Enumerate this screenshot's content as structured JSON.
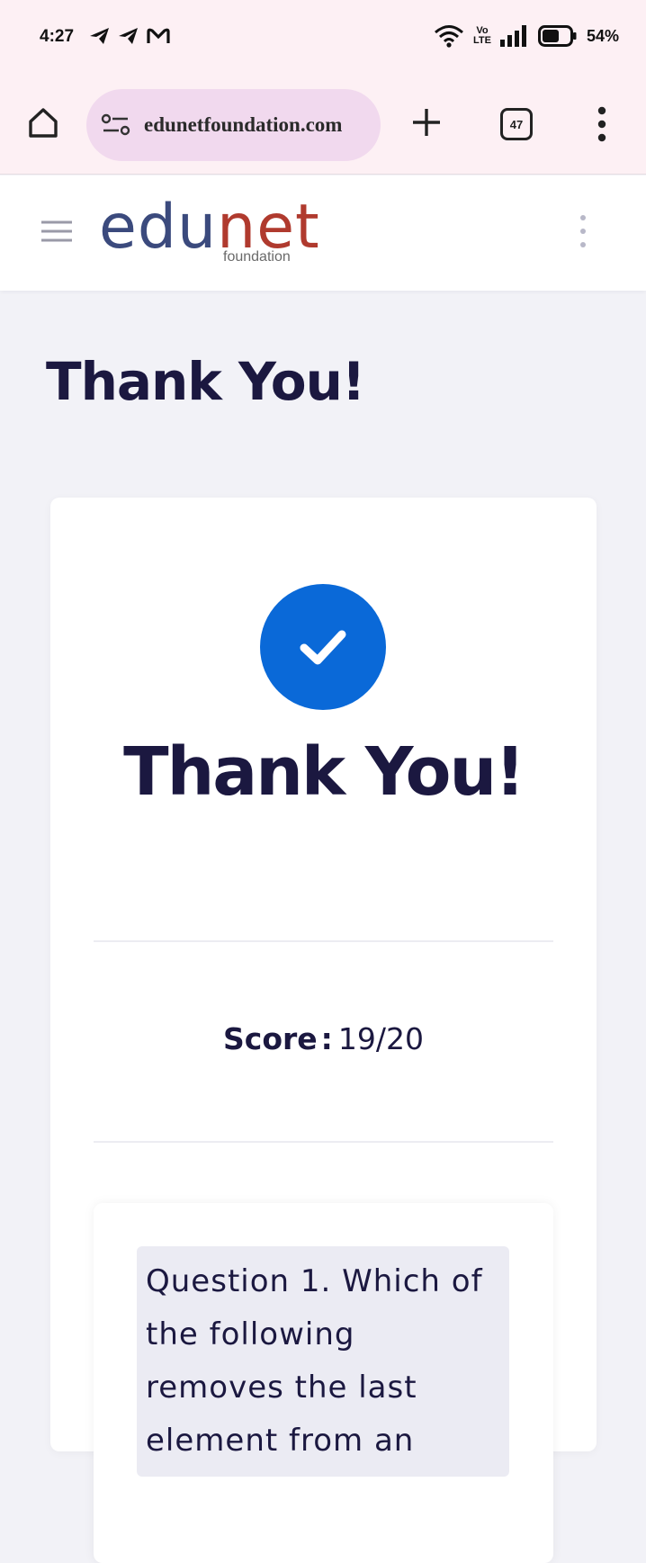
{
  "status_bar": {
    "time": "4:27",
    "notification_icons": [
      "telegram-icon",
      "telegram-icon",
      "gmail-icon"
    ],
    "network": "Vo LTE",
    "volte_top": "Vo",
    "volte_bottom": "LTE",
    "battery": "54%"
  },
  "browser": {
    "url": "edunetfoundation.com",
    "tab_count": "47"
  },
  "site_header": {
    "logo_part1": "edu",
    "logo_part2": "net",
    "logo_sub": "foundation"
  },
  "page": {
    "title": "Thank You!",
    "card_title": "Thank You!",
    "score_label": "Score",
    "score_separator": ":",
    "score_value": "19/20",
    "question_text": "Question 1. Which of the following removes the last element from an"
  },
  "colors": {
    "accent_blue": "#0a69d8",
    "heading_navy": "#1b1840",
    "logo_edu": "#3b4a7d",
    "logo_net": "#b03a2e",
    "browser_bg": "#fdf0f4",
    "url_pill": "#f1d9ee"
  }
}
